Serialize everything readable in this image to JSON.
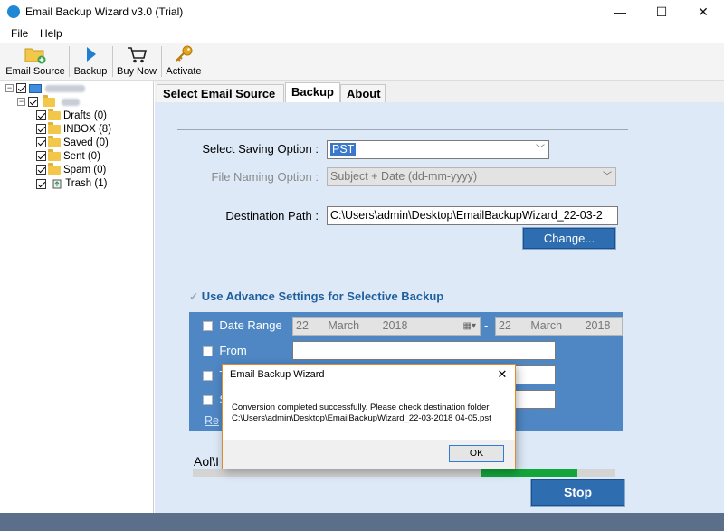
{
  "window": {
    "title": "Email Backup Wizard v3.0 (Trial)",
    "minimize": "—",
    "maximize": "☐",
    "close": "✕"
  },
  "menu": {
    "file": "File",
    "help": "Help"
  },
  "toolbar": {
    "email_source": "Email Source",
    "backup": "Backup",
    "buy_now": "Buy Now",
    "activate": "Activate"
  },
  "tree": {
    "items": [
      {
        "label": "Drafts (0)"
      },
      {
        "label": "INBOX (8)"
      },
      {
        "label": "Saved (0)"
      },
      {
        "label": "Sent (0)"
      },
      {
        "label": "Spam (0)"
      },
      {
        "label": "Trash (1)"
      }
    ]
  },
  "tabs": {
    "select_email_source": "Select Email Source",
    "backup": "Backup",
    "about": "About"
  },
  "form": {
    "saving_option_label": "Select Saving Option  :",
    "saving_option_value": "PST",
    "file_naming_label": "File Naming Option  :",
    "file_naming_value": "Subject + Date (dd-mm-yyyy)",
    "destination_label": "Destination Path  :",
    "destination_value": "C:\\Users\\admin\\Desktop\\EmailBackupWizard_22-03-2",
    "change_button": "Change..."
  },
  "advance": {
    "title": "Use Advance Settings for Selective Backup",
    "date_range_label": "Date Range",
    "from_date": {
      "day": "22",
      "month": "March",
      "year": "2018"
    },
    "date_sep": "-",
    "to_date": {
      "day": "22",
      "month": "March",
      "year": "2018"
    },
    "from_label": "From",
    "to_label_partial": "T",
    "subject_label_partial": "S",
    "reset_partial": "Re"
  },
  "status": {
    "path_partial": "Aol\\I"
  },
  "progress": {
    "fraction": 0.23
  },
  "stop_button": "Stop",
  "dialog": {
    "title": "Email Backup Wizard",
    "close": "✕",
    "message_line1": "Conversion completed successfully. Please check destination folder",
    "message_line2": "C:\\Users\\admin\\Desktop\\EmailBackupWizard_22-03-2018 04-05.pst",
    "ok": "OK"
  },
  "colors": {
    "accent": "#2f6db1",
    "panel": "#dde9f7",
    "progress": "#14a53a",
    "dialog_border": "#e08a2e"
  }
}
